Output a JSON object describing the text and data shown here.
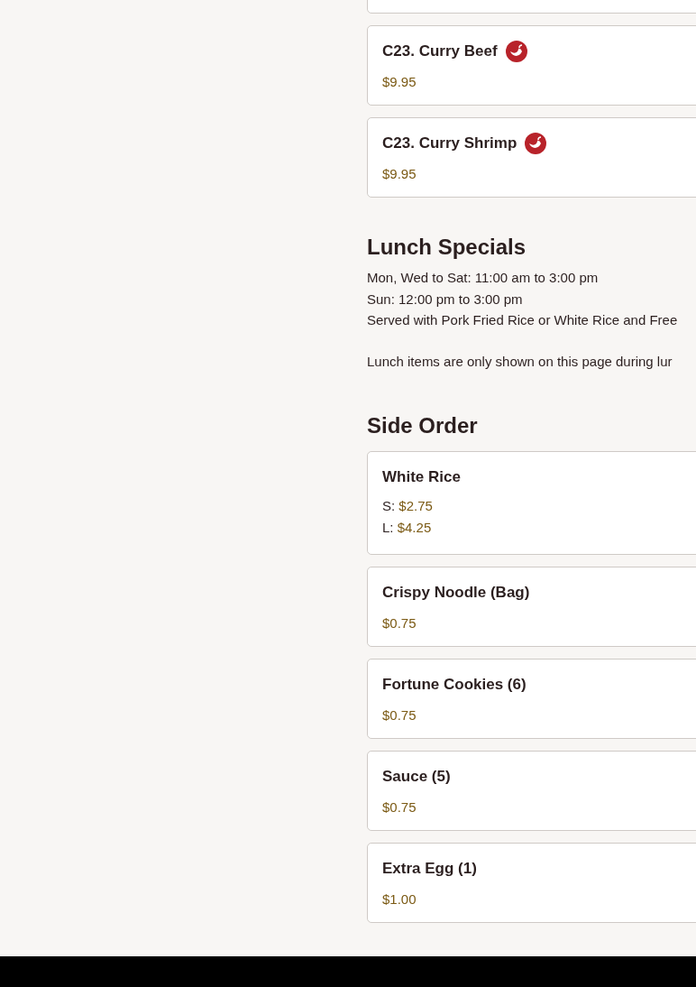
{
  "top_items": [
    {
      "name": "C23. Curry Beef",
      "spicy": true,
      "kind": "single",
      "price": "$9.95"
    },
    {
      "name": "C23. Curry Shrimp",
      "spicy": true,
      "kind": "single",
      "price": "$9.95"
    }
  ],
  "lunch_specials": {
    "title": "Lunch Specials",
    "lines": [
      "Mon, Wed to Sat: 11:00 am to 3:00 pm",
      "Sun: 12:00 pm to 3:00 pm",
      "Served with Pork Fried Rice or White Rice and Free"
    ],
    "note": "Lunch items are only shown on this page during lur"
  },
  "side_order": {
    "title": "Side Order",
    "items": [
      {
        "name": "White Rice",
        "spicy": false,
        "kind": "sized",
        "prices": [
          {
            "size": "S:",
            "price": "$2.75"
          },
          {
            "size": "L:",
            "price": "$4.25"
          }
        ]
      },
      {
        "name": "Crispy Noodle (Bag)",
        "spicy": false,
        "kind": "single",
        "price": "$0.75"
      },
      {
        "name": "Fortune Cookies (6)",
        "spicy": false,
        "kind": "single",
        "price": "$0.75"
      },
      {
        "name": "Sauce (5)",
        "spicy": false,
        "kind": "single",
        "price": "$0.75"
      },
      {
        "name": "Extra Egg (1)",
        "spicy": false,
        "kind": "single",
        "price": "$1.00"
      }
    ]
  }
}
